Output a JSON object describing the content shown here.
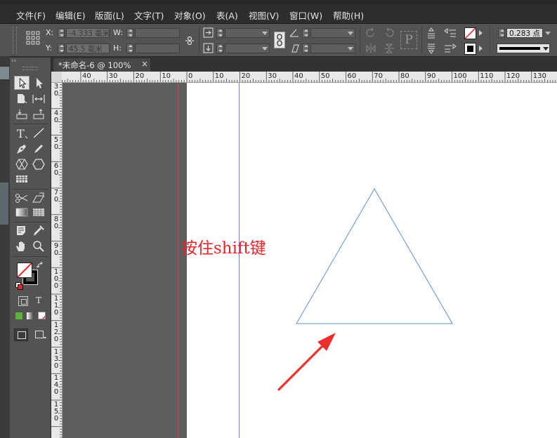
{
  "colors": {
    "accent_red": "#e8252a",
    "shape_blue": "#5b8fd8",
    "guide_blue": "#7b7bff",
    "panel_bg": "#535353",
    "pasteboard": "#5e5e5e"
  },
  "menu": {
    "items": [
      "文件(F)",
      "编辑(E)",
      "版面(L)",
      "文字(T)",
      "对象(O)",
      "表(A)",
      "视图(V)",
      "窗口(W)",
      "帮助(H)"
    ]
  },
  "control_panel": {
    "x_label": "X:",
    "y_label": "Y:",
    "w_label": "W:",
    "h_label": "H:",
    "x_value": "-4.333 毫米",
    "y_value": "45.5 毫米",
    "w_value": "",
    "h_value": "",
    "stroke_weight": "0.283 点"
  },
  "document_tab": {
    "title": "*未命名-6 @ 100%",
    "close": "×"
  },
  "rulers": {
    "horizontal": [
      "40",
      "30",
      "20",
      "10",
      "0",
      "10",
      "20",
      "30",
      "40",
      "50",
      "60",
      "70",
      "80",
      "90",
      "100",
      "110",
      "120",
      "130"
    ],
    "vertical": [
      "30",
      "40",
      "50",
      "60",
      "70",
      "80",
      "90",
      "100",
      "110",
      "120",
      "130",
      "140",
      "150"
    ]
  },
  "canvas": {
    "annotation": "按住shift键",
    "shape": "triangle"
  },
  "icons": {
    "toolbox": [
      "selection-tool-icon",
      "direct-selection-tool-icon",
      "page-tool-icon",
      "gap-tool-icon",
      "content-collector-icon",
      "content-placer-icon",
      "type-tool-icon",
      "line-tool-icon",
      "pen-tool-icon",
      "pencil-tool-icon",
      "rectangle-frame-tool-icon",
      "rectangle-tool-icon",
      "table-tool-icon",
      "scissors-tool-icon",
      "free-transform-tool-icon",
      "gradient-swatch-tool-icon",
      "gradient-feather-tool-icon",
      "note-tool-icon",
      "eyedropper-tool-icon",
      "hand-tool-icon",
      "zoom-tool-icon"
    ]
  }
}
